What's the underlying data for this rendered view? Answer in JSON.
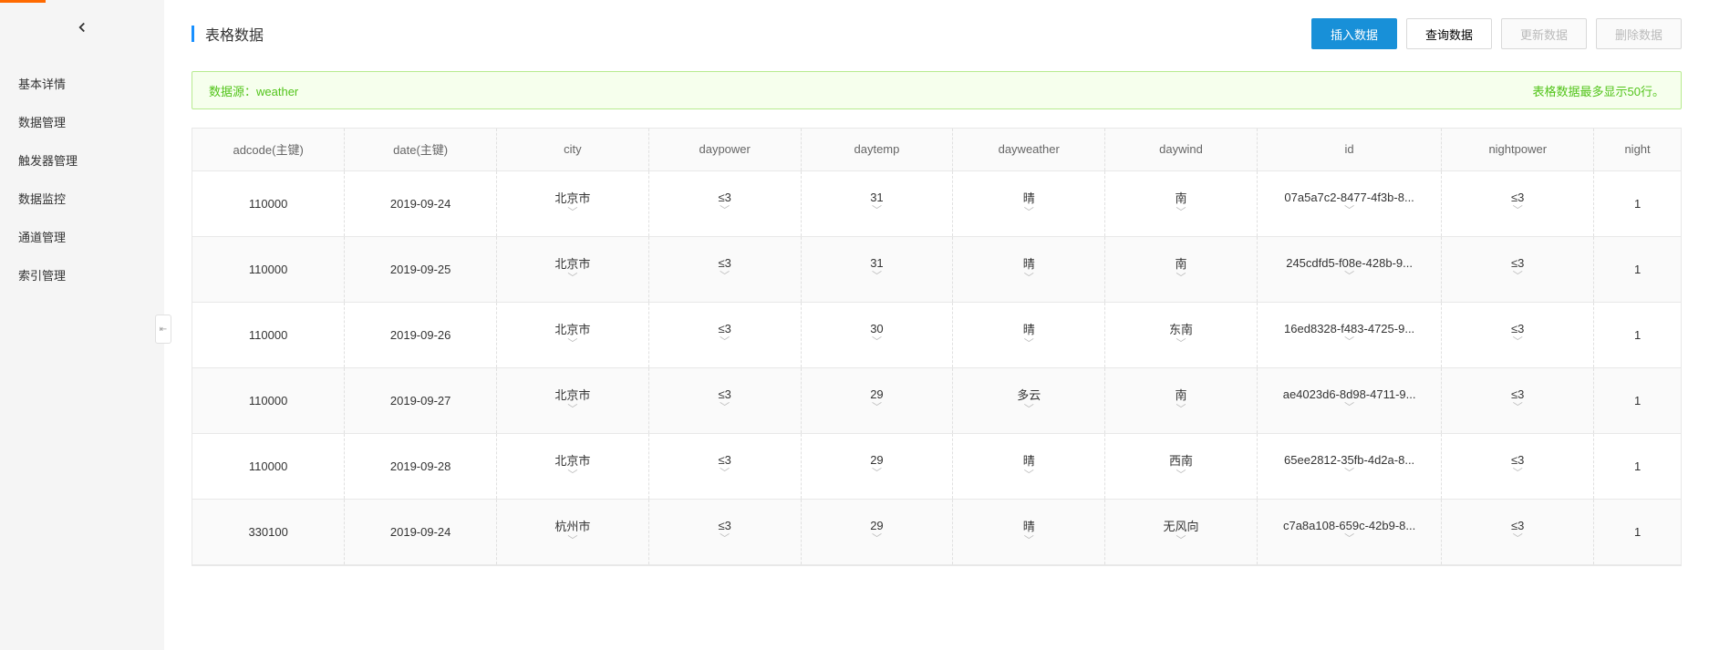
{
  "sidebar": {
    "items": [
      {
        "label": "基本详情"
      },
      {
        "label": "数据管理"
      },
      {
        "label": "触发器管理"
      },
      {
        "label": "数据监控"
      },
      {
        "label": "通道管理"
      },
      {
        "label": "索引管理"
      }
    ]
  },
  "page": {
    "title": "表格数据"
  },
  "actions": {
    "insert": "插入数据",
    "query": "查询数据",
    "update": "更新数据",
    "delete": "删除数据"
  },
  "alert": {
    "source_label": "数据源：",
    "source_value": "weather",
    "limit_text": "表格数据最多显示50行。"
  },
  "table": {
    "headers": {
      "adcode": "adcode(主键)",
      "date": "date(主键)",
      "city": "city",
      "daypower": "daypower",
      "daytemp": "daytemp",
      "dayweather": "dayweather",
      "daywind": "daywind",
      "id": "id",
      "nightpower": "nightpower",
      "night": "night"
    },
    "rows": [
      {
        "adcode": "110000",
        "date": "2019-09-24",
        "city": "北京市",
        "daypower": "≤3",
        "daytemp": "31",
        "dayweather": "晴",
        "daywind": "南",
        "id": "07a5a7c2-8477-4f3b-8...",
        "nightpower": "≤3",
        "night": "1"
      },
      {
        "adcode": "110000",
        "date": "2019-09-25",
        "city": "北京市",
        "daypower": "≤3",
        "daytemp": "31",
        "dayweather": "晴",
        "daywind": "南",
        "id": "245cdfd5-f08e-428b-9...",
        "nightpower": "≤3",
        "night": "1"
      },
      {
        "adcode": "110000",
        "date": "2019-09-26",
        "city": "北京市",
        "daypower": "≤3",
        "daytemp": "30",
        "dayweather": "晴",
        "daywind": "东南",
        "id": "16ed8328-f483-4725-9...",
        "nightpower": "≤3",
        "night": "1"
      },
      {
        "adcode": "110000",
        "date": "2019-09-27",
        "city": "北京市",
        "daypower": "≤3",
        "daytemp": "29",
        "dayweather": "多云",
        "daywind": "南",
        "id": "ae4023d6-8d98-4711-9...",
        "nightpower": "≤3",
        "night": "1"
      },
      {
        "adcode": "110000",
        "date": "2019-09-28",
        "city": "北京市",
        "daypower": "≤3",
        "daytemp": "29",
        "dayweather": "晴",
        "daywind": "西南",
        "id": "65ee2812-35fb-4d2a-8...",
        "nightpower": "≤3",
        "night": "1"
      },
      {
        "adcode": "330100",
        "date": "2019-09-24",
        "city": "杭州市",
        "daypower": "≤3",
        "daytemp": "29",
        "dayweather": "晴",
        "daywind": "无风向",
        "id": "c7a8a108-659c-42b9-8...",
        "nightpower": "≤3",
        "night": "1"
      }
    ]
  }
}
